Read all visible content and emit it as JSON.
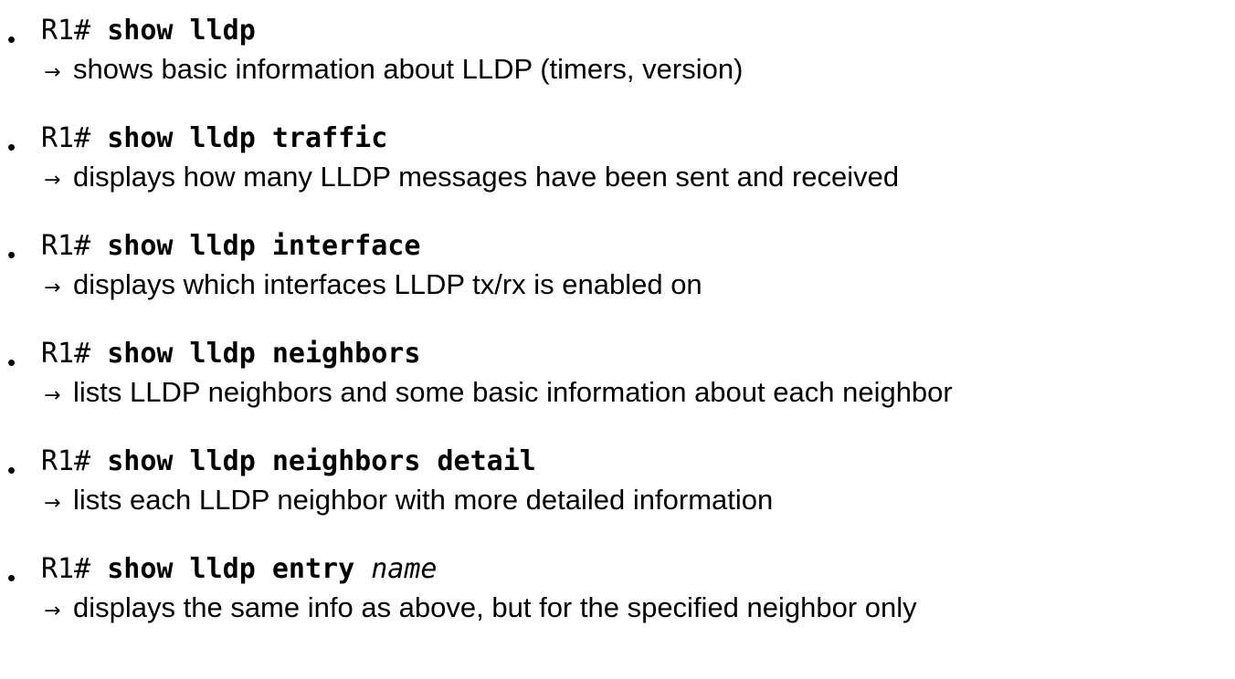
{
  "bullet_glyph": "•",
  "arrow_glyph": "→",
  "items": [
    {
      "prompt": "R1# ",
      "command": "show lldp",
      "argument": "",
      "description": "shows basic information about LLDP (timers, version)"
    },
    {
      "prompt": "R1# ",
      "command": "show lldp traffic",
      "argument": "",
      "description": "displays how many LLDP messages have been sent and received"
    },
    {
      "prompt": "R1# ",
      "command": "show lldp interface",
      "argument": "",
      "description": "displays which interfaces LLDP tx/rx is enabled on"
    },
    {
      "prompt": "R1# ",
      "command": "show lldp neighbors",
      "argument": "",
      "description": "lists LLDP neighbors and some basic information about each neighbor"
    },
    {
      "prompt": "R1# ",
      "command": "show lldp neighbors detail",
      "argument": "",
      "description": "lists each LLDP neighbor with more detailed information"
    },
    {
      "prompt": "R1# ",
      "command": "show lldp entry",
      "argument": "name",
      "description": "displays the same info as above, but for the specified neighbor only"
    }
  ]
}
